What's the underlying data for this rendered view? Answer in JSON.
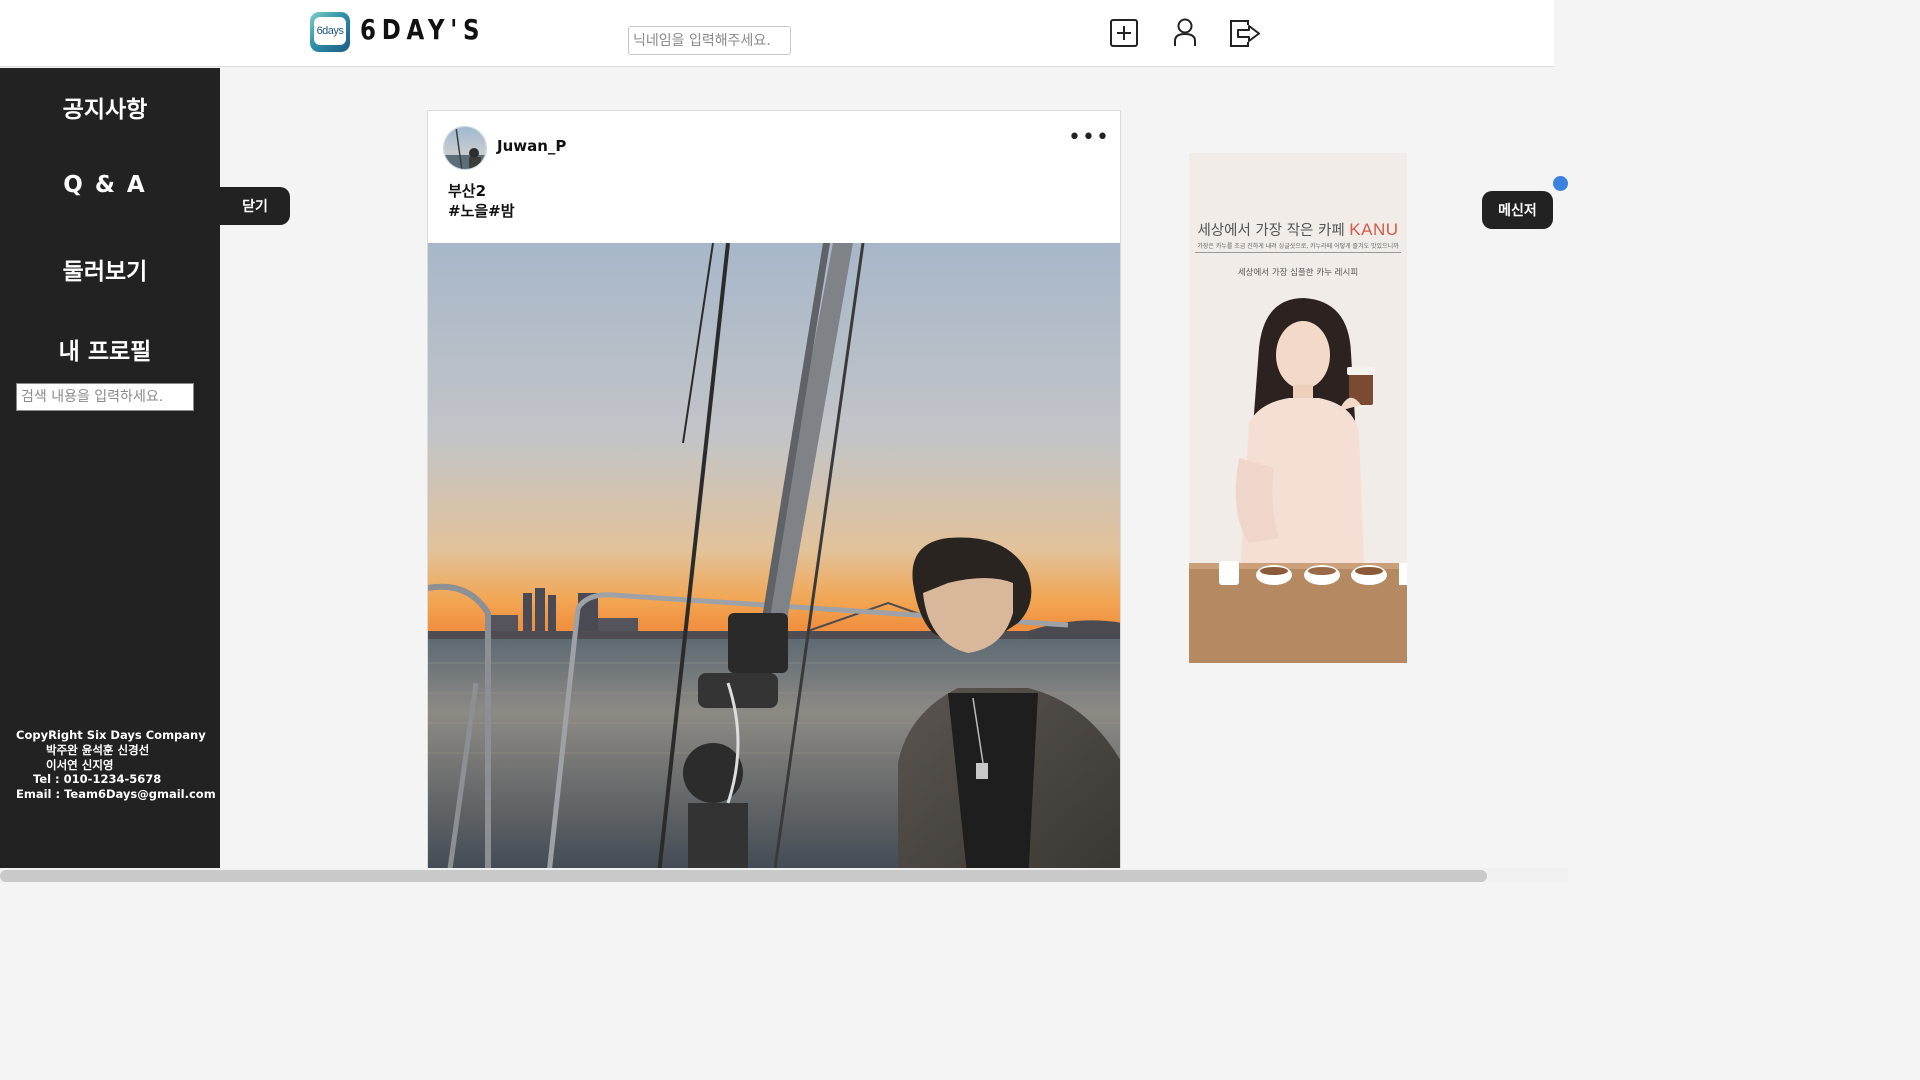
{
  "header": {
    "logo_badge": "6days",
    "logo_text": "6DAY'S",
    "nickname_search_placeholder": "닉네임을 입력해주세요.",
    "icons": [
      "add-post-icon",
      "profile-icon",
      "logout-icon"
    ]
  },
  "sidebar": {
    "items": [
      {
        "label": "공지사항"
      },
      {
        "label": "Q & A"
      },
      {
        "label": "둘러보기"
      },
      {
        "label": "내 프로필"
      }
    ],
    "search_placeholder": "검색 내용을 입력하세요.",
    "copyright": {
      "line1": "CopyRight Six Days Company",
      "line2": "박주완 윤석훈 신경선",
      "line3": "이서연 신지영",
      "line4": "Tel : 010-1234-5678",
      "line5": "Email : Team6Days@gmail.com"
    }
  },
  "close_button": "닫기",
  "messenger_button": "메신저",
  "post": {
    "username": "Juwan_P",
    "more": "•••",
    "caption_line1": "부산2",
    "caption_line2": "#노을#밤"
  },
  "ad": {
    "headline": "세상에서 가장 작은 카페",
    "brand": "KANU",
    "subline": "가장은 카누를 조금 진하게 내려 싱글샷으로, 카누라떼 어떻게 즐겨도 맛있으니까",
    "tagline": "세상에서 가장 심플한 카누 레시피"
  },
  "colors": {
    "sidebar_bg": "#222222",
    "page_bg": "#f4f4f4",
    "accent_blue": "#3b82e0",
    "kanu_red": "#d45a4a"
  }
}
